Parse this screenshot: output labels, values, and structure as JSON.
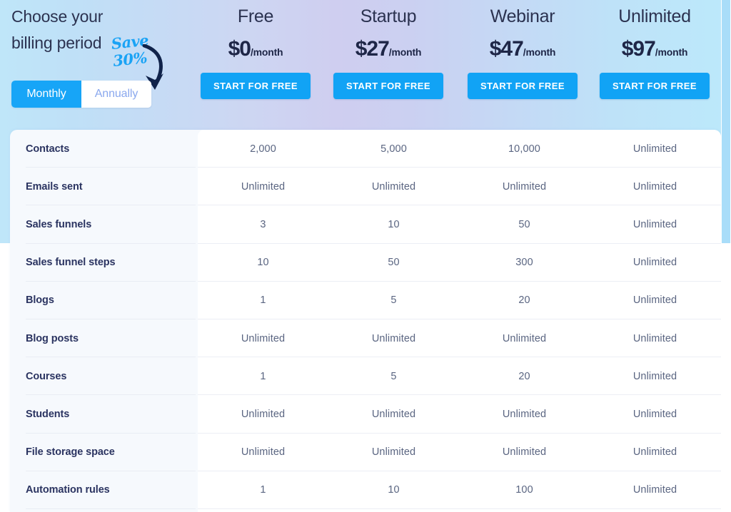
{
  "colors": {
    "accent_blue": "#11a3f5",
    "toggle_active_bg": "#17a5f7",
    "heading_navy": "#2b3250",
    "feature_label": "#2b3461",
    "cell_text": "#5a6581",
    "card_left_bg": "#f6f9fd",
    "save_badge_blue": "#1aa3f5",
    "arrow_navy": "#10234a",
    "scrollbar_thumb": "#a9ddf9"
  },
  "billing": {
    "heading_line1": "Choose your",
    "heading_line2": "billing period",
    "save_badge_line1": "Save",
    "save_badge_line2": "30%",
    "arrow_icon": "curved-down-arrow-icon",
    "toggle": {
      "options": [
        {
          "label": "Monthly",
          "selected": true
        },
        {
          "label": "Annually",
          "selected": false
        }
      ]
    }
  },
  "plans": [
    {
      "name": "Free",
      "price": "$0",
      "period": "/month",
      "cta": "START FOR FREE"
    },
    {
      "name": "Startup",
      "price": "$27",
      "period": "/month",
      "cta": "START FOR FREE"
    },
    {
      "name": "Webinar",
      "price": "$47",
      "period": "/month",
      "cta": "START FOR FREE"
    },
    {
      "name": "Unlimited",
      "price": "$97",
      "period": "/month",
      "cta": "START FOR FREE"
    }
  ],
  "comparison": {
    "columns": [
      "Free",
      "Startup",
      "Webinar",
      "Unlimited"
    ],
    "rows": [
      {
        "feature": "Contacts",
        "values": [
          "2,000",
          "5,000",
          "10,000",
          "Unlimited"
        ]
      },
      {
        "feature": "Emails sent",
        "values": [
          "Unlimited",
          "Unlimited",
          "Unlimited",
          "Unlimited"
        ]
      },
      {
        "feature": "Sales funnels",
        "values": [
          "3",
          "10",
          "50",
          "Unlimited"
        ]
      },
      {
        "feature": "Sales funnel steps",
        "values": [
          "10",
          "50",
          "300",
          "Unlimited"
        ]
      },
      {
        "feature": "Blogs",
        "values": [
          "1",
          "5",
          "20",
          "Unlimited"
        ]
      },
      {
        "feature": "Blog posts",
        "values": [
          "Unlimited",
          "Unlimited",
          "Unlimited",
          "Unlimited"
        ]
      },
      {
        "feature": "Courses",
        "values": [
          "1",
          "5",
          "20",
          "Unlimited"
        ]
      },
      {
        "feature": "Students",
        "values": [
          "Unlimited",
          "Unlimited",
          "Unlimited",
          "Unlimited"
        ]
      },
      {
        "feature": "File storage space",
        "values": [
          "Unlimited",
          "Unlimited",
          "Unlimited",
          "Unlimited"
        ]
      },
      {
        "feature": "Automation rules",
        "values": [
          "1",
          "10",
          "100",
          "Unlimited"
        ]
      }
    ]
  },
  "scrollbar": {
    "orientation": "vertical",
    "thumb_position_percent": 0
  }
}
